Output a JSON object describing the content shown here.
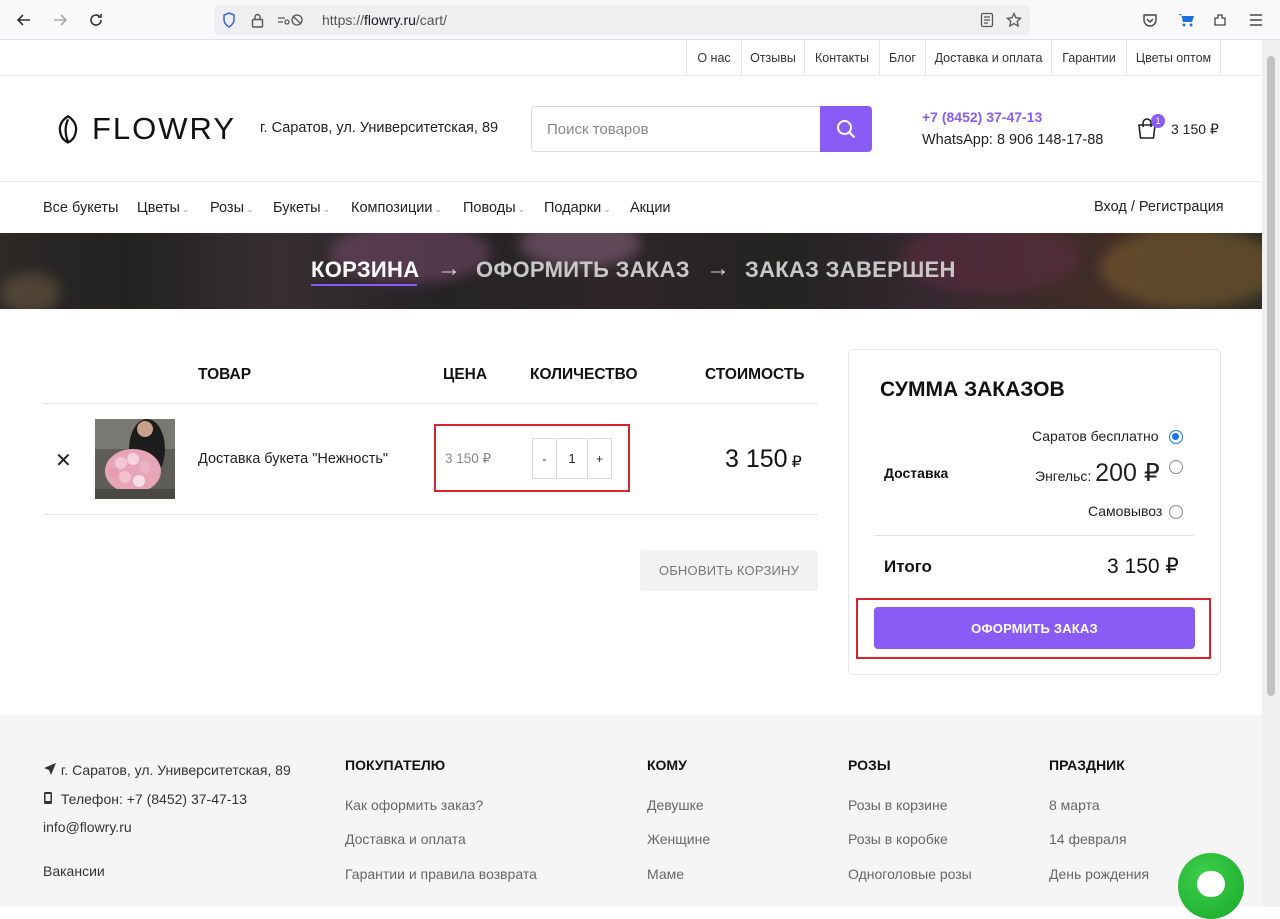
{
  "browser": {
    "url_prefix": "https://",
    "url_host": "flowry.ru",
    "url_path": "/cart/"
  },
  "top_links": [
    "О нас",
    "Отзывы",
    "Контакты",
    "Блог",
    "Доставка и оплата",
    "Гарантии",
    "Цветы оптом"
  ],
  "header": {
    "logo_text": "FLOWRY",
    "address": "г. Саратов, ул. Университетская, 89",
    "search_placeholder": "Поиск товаров",
    "phone": "+7 (8452) 37-47-13",
    "whatsapp": "WhatsApp: 8 906 148-17-88",
    "cart_count": "1",
    "cart_total": "3 150 ₽"
  },
  "nav": {
    "items": [
      "Все букеты",
      "Цветы",
      "Розы",
      "Букеты",
      "Композиции",
      "Поводы",
      "Подарки",
      "Акции"
    ],
    "caret": "⌄",
    "login": "Вход / Регистрация"
  },
  "steps": {
    "cart": "КОРЗИНА",
    "checkout": "ОФОРМИТЬ ЗАКАЗ",
    "done": "ЗАКАЗ ЗАВЕРШЕН",
    "arrow": "→"
  },
  "cart_table": {
    "headers": {
      "product": "ТОВАР",
      "price": "ЦЕНА",
      "qty": "КОЛИЧЕСТВО",
      "subtotal": "СТОИМОСТЬ"
    },
    "rows": [
      {
        "remove": "✕",
        "name": "Доставка букета \"Нежность\"",
        "price": "3 150 ₽",
        "qty": "1",
        "minus": "-",
        "plus": "+",
        "subtotal_value": "3 150",
        "subtotal_currency": "₽"
      }
    ],
    "update_button": "ОБНОВИТЬ КОРЗИНУ"
  },
  "totals": {
    "title": "СУММА ЗАКАЗОВ",
    "shipping_label": "Доставка",
    "options": [
      {
        "label": "Саратов бесплатно",
        "selected": true
      },
      {
        "label": "Энгельс:",
        "price": "200 ₽",
        "selected": false
      },
      {
        "label": "Самовывоз",
        "selected": false
      }
    ],
    "total_label": "Итого",
    "total_value": "3 150 ₽",
    "checkout_button": "ОФОРМИТЬ ЗАКАЗ"
  },
  "footer": {
    "address": "г. Саратов, ул. Университетская, 89",
    "phone": "Телефон: +7 (8452) 37-47-13",
    "email": "info@flowry.ru",
    "vacancies": "Вакансии",
    "columns": [
      {
        "title": "ПОКУПАТЕЛЮ",
        "links": [
          "Как оформить заказ?",
          "Доставка и оплата",
          "Гарантии и правила возврата"
        ]
      },
      {
        "title": "КОМУ",
        "links": [
          "Девушке",
          "Женщине",
          "Маме"
        ]
      },
      {
        "title": "РОЗЫ",
        "links": [
          "Розы в корзине",
          "Розы в коробке",
          "Одноголовые розы"
        ]
      },
      {
        "title": "ПРАЗДНИК",
        "links": [
          "8 марта",
          "14 февраля",
          "День рождения"
        ]
      }
    ]
  },
  "colors": {
    "accent": "#8a5cf6",
    "highlight_box": "#d9232d",
    "chat": "#1fb82e"
  }
}
